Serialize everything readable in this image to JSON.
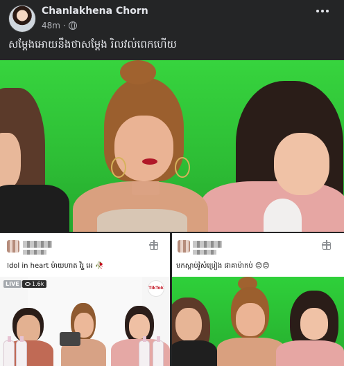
{
  "post": {
    "author": "Chanlakhena Chorn",
    "timestamp": "48m",
    "caption": "សម្ដែងអោយនឹងថាសម្ដែង  រិលវល់ពេកហើយ"
  },
  "cards": {
    "left": {
      "comment": "Idol in heart ម៉ាយហាត វិរ្តួ អេ 🥀",
      "live_label": "LIVE",
      "viewers": "1.6k",
      "brand": "TikTok"
    },
    "right": {
      "comment": "មកស្ដាប់វ៉ូសំប្រៀង ផាគាម៉ាកប់ 😊😊"
    }
  },
  "colors": {
    "background": "#242526",
    "green_screen": "#32c83a"
  }
}
